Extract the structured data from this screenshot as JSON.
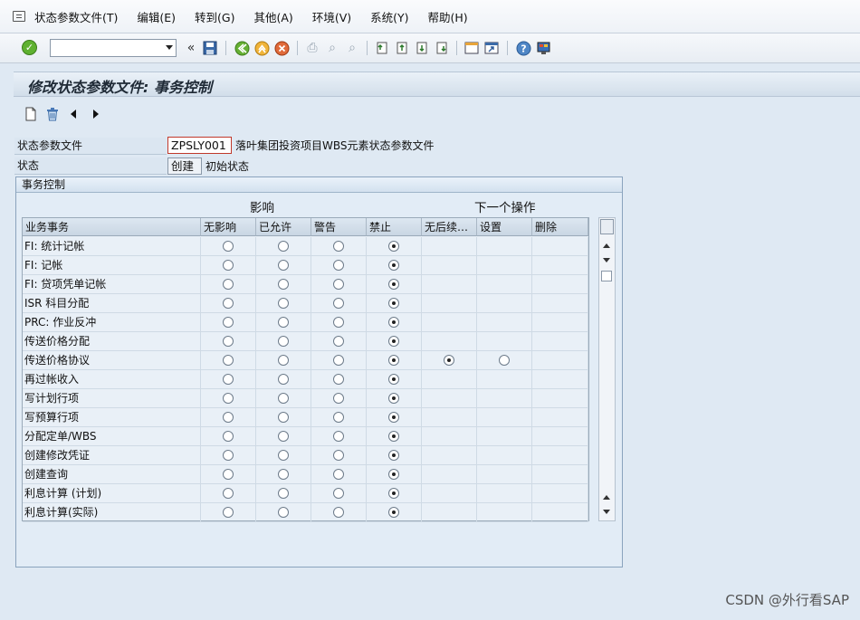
{
  "menu": {
    "items": [
      "状态参数文件(T)",
      "编辑(E)",
      "转到(G)",
      "其他(A)",
      "环境(V)",
      "系统(Y)",
      "帮助(H)"
    ]
  },
  "toolbar": {
    "command_field": ""
  },
  "title": "修改状态参数文件: 事务控制",
  "form": {
    "profile_label": "状态参数文件",
    "profile_value": "ZPSLY001",
    "profile_desc": "落叶集团投资项目WBS元素状态参数文件",
    "status_label": "状态",
    "status_value": "创建",
    "status_desc": "初始状态"
  },
  "group": {
    "title": "事务控制",
    "section_influence": "影响",
    "section_next_op": "下一个操作"
  },
  "table": {
    "headers": [
      "业务事务",
      "无影响",
      "已允许",
      "警告",
      "禁止",
      "无后续…",
      "设置",
      "删除"
    ],
    "rows": [
      {
        "label": "FI: 统计记帐",
        "sel": 3,
        "extra": []
      },
      {
        "label": "FI: 记帐",
        "sel": 3,
        "extra": []
      },
      {
        "label": "FI: 贷项凭单记帐",
        "sel": 3,
        "extra": []
      },
      {
        "label": "ISR 科目分配",
        "sel": 3,
        "extra": []
      },
      {
        "label": "PRC: 作业反冲",
        "sel": 3,
        "extra": []
      },
      {
        "label": "传送价格分配",
        "sel": 3,
        "extra": []
      },
      {
        "label": "传送价格协议",
        "sel": 3,
        "extra": [
          true,
          false
        ]
      },
      {
        "label": "再过帐收入",
        "sel": 3,
        "extra": []
      },
      {
        "label": "写计划行项",
        "sel": 3,
        "extra": []
      },
      {
        "label": "写预算行项",
        "sel": 3,
        "extra": []
      },
      {
        "label": "分配定单/WBS",
        "sel": 3,
        "extra": []
      },
      {
        "label": "创建修改凭证",
        "sel": 3,
        "extra": []
      },
      {
        "label": "创建查询",
        "sel": 3,
        "extra": []
      },
      {
        "label": "利息计算 (计划)",
        "sel": 3,
        "extra": []
      },
      {
        "label": "利息计算(实际)",
        "sel": 3,
        "extra": []
      }
    ]
  },
  "watermark": "CSDN @外行看SAP"
}
